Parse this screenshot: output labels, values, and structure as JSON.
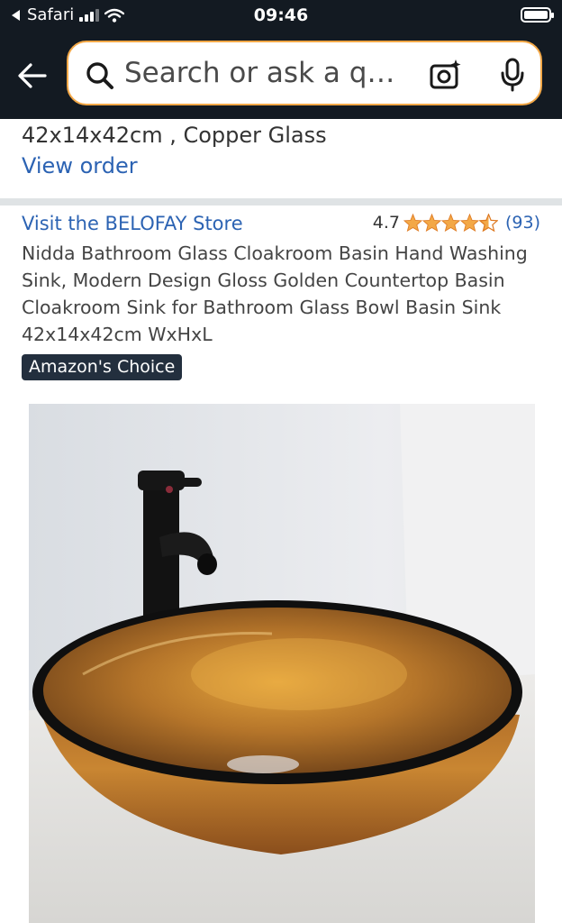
{
  "status": {
    "carrier": "Safari",
    "time": "09:46"
  },
  "search": {
    "placeholder": "Search or ask a q…"
  },
  "previous_item": {
    "description": "42x14x42cm , Copper Glass",
    "view_order": "View order"
  },
  "product": {
    "store": "Visit the BELOFAY Store",
    "rating": "4.7",
    "stars": 4.5,
    "rating_count": "(93)",
    "title": "Nidda Bathroom Glass Cloakroom Basin Hand Washing Sink, Modern Design Gloss Golden Countertop Basin Cloakroom Sink for Bathroom Glass Bowl Basin Sink 42x14x42cm WxHxL",
    "badge": "Amazon's Choice",
    "image": "copper-glass-vessel-sink-with-black-faucet"
  },
  "colors": {
    "nav_bg": "#131a22",
    "link": "#2c63b3",
    "star": "#f3a847",
    "badge_bg": "#232f3e"
  }
}
